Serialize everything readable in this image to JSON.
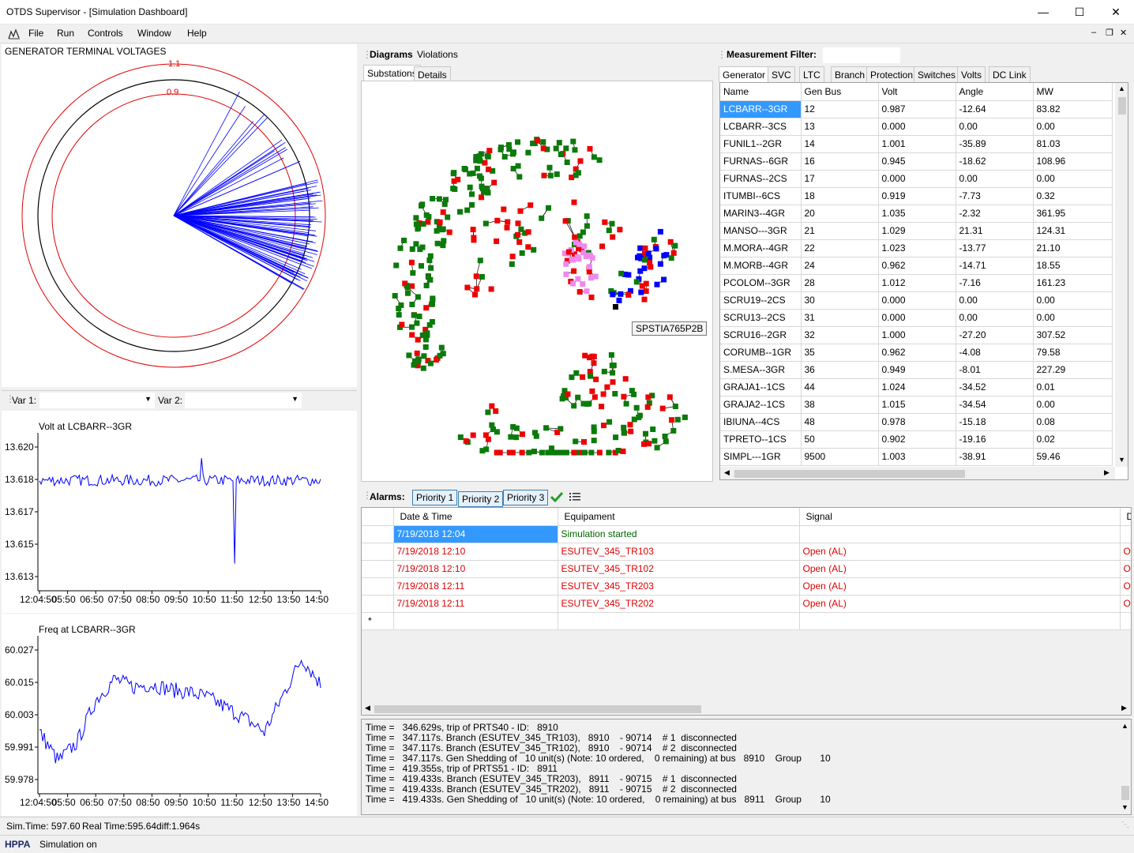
{
  "window": {
    "title": "OTDS Supervisor - [Simulation Dashboard]"
  },
  "menu": [
    "File",
    "Run",
    "Controls",
    "Window",
    "Help"
  ],
  "polar": {
    "title": "GENERATOR TERMINAL VOLTAGES",
    "ring_outer": "1.1",
    "ring_inner": "0.9"
  },
  "var_select": {
    "var1_label": "Var 1:",
    "var2_label": "Var 2:"
  },
  "volt_chart": {
    "title": "Volt at LCBARR--3GR",
    "yticks": [
      "13.620",
      "13.618",
      "13.617",
      "13.615",
      "13.613"
    ],
    "xticks": [
      "12:04:50",
      "05:50",
      "06:50",
      "07:50",
      "08:50",
      "09:50",
      "10:50",
      "11:50",
      "12:50",
      "13:50",
      "14:50"
    ]
  },
  "freq_chart": {
    "title": "Freq at LCBARR--3GR",
    "yticks": [
      "60.027",
      "60.015",
      "60.003",
      "59.991",
      "59.978"
    ],
    "xticks": [
      "12:04:50",
      "05:50",
      "06:50",
      "07:50",
      "08:50",
      "09:50",
      "10:50",
      "11:50",
      "12:50",
      "13:50",
      "14:50"
    ]
  },
  "chart_data": [
    {
      "type": "line",
      "title": "Volt at LCBARR--3GR",
      "ylim": [
        13.613,
        13.62
      ],
      "x": [
        "12:04:50",
        "05:50",
        "06:50",
        "07:50",
        "08:50",
        "09:50",
        "10:50",
        "11:50",
        "12:50",
        "13:50",
        "14:50"
      ],
      "series": [
        {
          "color": "#0000ff",
          "baseline": 13.6182,
          "noise": 0.0003,
          "spikes": [
            {
              "x": "10:50",
              "value": 13.6194
            },
            {
              "x": "11:50",
              "value": 13.6137
            }
          ]
        }
      ]
    },
    {
      "type": "line",
      "title": "Freq at LCBARR--3GR",
      "ylim": [
        59.978,
        60.027
      ],
      "x": [
        "12:04:50",
        "05:50",
        "06:50",
        "07:50",
        "08:50",
        "09:50",
        "10:50",
        "11:50",
        "12:50",
        "13:50",
        "14:50"
      ],
      "series": [
        {
          "color": "#0000ff",
          "values": [
            59.996,
            59.985,
            59.992,
            60.008,
            60.016,
            60.013,
            60.014,
            60.012,
            60.011,
            60.009,
            60.005,
            60.001,
            59.996,
            60.01,
            60.024,
            60.014
          ]
        }
      ]
    }
  ],
  "diagrams": {
    "title": "Diagrams",
    "violations": "Violations",
    "tabs": [
      "Substations",
      "Details"
    ],
    "tooltip": "SPSTIA765P2B"
  },
  "measurement": {
    "title": "Measurement Filter:",
    "tabs": [
      "Generator",
      "SVC",
      "LTC",
      "Branch",
      "Protection",
      "Switches",
      "Volts",
      "DC Link"
    ],
    "columns": [
      "Name",
      "Gen Bus",
      "Volt",
      "Angle",
      "MW"
    ],
    "rows": [
      [
        "LCBARR--3GR",
        "12",
        "0.987",
        "-12.64",
        "83.82"
      ],
      [
        "LCBARR--3CS",
        "13",
        "0.000",
        "0.00",
        "0.00"
      ],
      [
        "FUNIL1--2GR",
        "14",
        "1.001",
        "-35.89",
        "81.03"
      ],
      [
        "FURNAS--6GR",
        "16",
        "0.945",
        "-18.62",
        "108.96"
      ],
      [
        "FURNAS--2CS",
        "17",
        "0.000",
        "0.00",
        "0.00"
      ],
      [
        "ITUMBI--6CS",
        "18",
        "0.919",
        "-7.73",
        "0.32"
      ],
      [
        "MARIN3--4GR",
        "20",
        "1.035",
        "-2.32",
        "361.95"
      ],
      [
        "MANSO---3GR",
        "21",
        "1.029",
        "21.31",
        "124.31"
      ],
      [
        "M.MORA--4GR",
        "22",
        "1.023",
        "-13.77",
        "21.10"
      ],
      [
        "M.MORB--4GR",
        "24",
        "0.962",
        "-14.71",
        "18.55"
      ],
      [
        "PCOLOM--3GR",
        "28",
        "1.012",
        "-7.16",
        "161.23"
      ],
      [
        "SCRU19--2CS",
        "30",
        "0.000",
        "0.00",
        "0.00"
      ],
      [
        "SCRU13--2CS",
        "31",
        "0.000",
        "0.00",
        "0.00"
      ],
      [
        "SCRU16--2GR",
        "32",
        "1.000",
        "-27.20",
        "307.52"
      ],
      [
        "CORUMB--1GR",
        "35",
        "0.962",
        "-4.08",
        "79.58"
      ],
      [
        "S.MESA--3GR",
        "36",
        "0.949",
        "-8.01",
        "227.29"
      ],
      [
        "GRAJA1--1CS",
        "44",
        "1.024",
        "-34.52",
        "0.01"
      ],
      [
        "GRAJA2--1CS",
        "38",
        "1.015",
        "-34.54",
        "0.00"
      ],
      [
        "IBIUNA--4CS",
        "48",
        "0.978",
        "-15.18",
        "0.08"
      ],
      [
        "TPRETO--1CS",
        "50",
        "0.902",
        "-19.16",
        "0.02"
      ],
      [
        "SIMPL---1GR",
        "9500",
        "1.003",
        "-38.91",
        "59.46"
      ]
    ]
  },
  "alarms": {
    "title": "Alarms:",
    "buttons": [
      "Priority 1",
      "Priority 2",
      "Priority 3"
    ],
    "columns": [
      "Date & Time",
      "Equipament",
      "Signal",
      "D"
    ],
    "rows": [
      {
        "time": "7/19/2018 12:04",
        "equip": "Simulation started",
        "signal": "",
        "desc": "",
        "color": "green"
      },
      {
        "time": "7/19/2018 12:10",
        "equip": "ESUTEV_345_TR103",
        "signal": "Open (AL)",
        "desc": "Op",
        "color": "red"
      },
      {
        "time": "7/19/2018 12:10",
        "equip": "ESUTEV_345_TR102",
        "signal": "Open (AL)",
        "desc": "Op",
        "color": "red"
      },
      {
        "time": "7/19/2018 12:11",
        "equip": "ESUTEV_345_TR203",
        "signal": "Open (AL)",
        "desc": "Op",
        "color": "red"
      },
      {
        "time": "7/19/2018 12:11",
        "equip": "ESUTEV_345_TR202",
        "signal": "Open (AL)",
        "desc": "Op",
        "color": "red"
      }
    ],
    "new_row_marker": "*"
  },
  "log": [
    "Time =   346.629s, trip of PRTS40 - ID:   8910",
    "Time =   347.117s. Branch (ESUTEV_345_TR103),   8910    - 90714    # 1  disconnected",
    "Time =   347.117s. Branch (ESUTEV_345_TR102),   8910    - 90714    # 2  disconnected",
    "Time =   347.117s. Gen Shedding of   10 unit(s) (Note: 10 ordered,    0 remaining) at bus   8910    Group       10",
    "Time =   419.355s, trip of PRTS51 - ID:   8911",
    "Time =   419.433s. Branch (ESUTEV_345_TR203),   8911    - 90715    # 1  disconnected",
    "Time =   419.433s. Branch (ESUTEV_345_TR202),   8911    - 90715    # 2  disconnected",
    "Time =   419.433s. Gen Shedding of   10 unit(s) (Note: 10 ordered,    0 remaining) at bus   8911    Group       10"
  ],
  "status": {
    "sim_time": "Sim.Time: 597.60",
    "real_time": "Real Time:595.64",
    "diff": "diff:1.964s",
    "brand": "HPPA",
    "state": "Simulation on"
  }
}
